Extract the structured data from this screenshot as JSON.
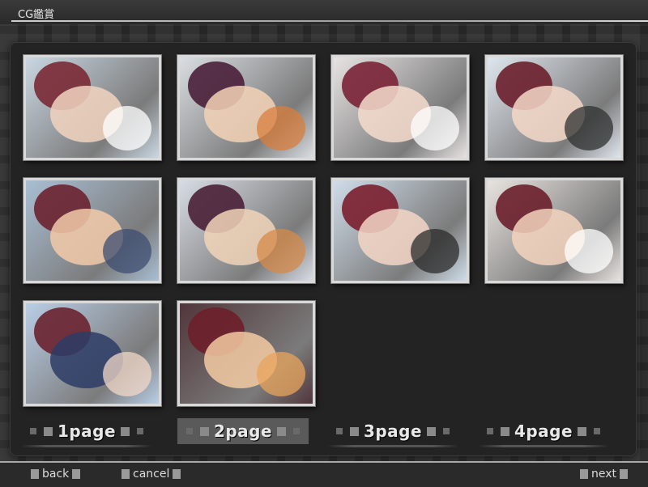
{
  "window": {
    "title": "CG鑑賞"
  },
  "gallery": {
    "thumbnails": [
      {
        "name": "cg-thumbnail-1",
        "bg": "#c9d7e2",
        "a": "#f1d3c0",
        "b": "#7a2a35",
        "c": "#ffffff"
      },
      {
        "name": "cg-thumbnail-2",
        "bg": "#d9dee2",
        "a": "#f3d2b6",
        "b": "#4a1f3a",
        "c": "#d97d3e"
      },
      {
        "name": "cg-thumbnail-3",
        "bg": "#e7e3e3",
        "a": "#f5dccd",
        "b": "#7a2236",
        "c": "#ffffff"
      },
      {
        "name": "cg-thumbnail-4",
        "bg": "#dfe6ee",
        "a": "#f4d8c8",
        "b": "#6a1f2c",
        "c": "#2f3232"
      },
      {
        "name": "cg-thumbnail-5",
        "bg": "#a9bfd4",
        "a": "#f2caa9",
        "b": "#6c2230",
        "c": "#3e4d72"
      },
      {
        "name": "cg-thumbnail-6",
        "bg": "#d7dce4",
        "a": "#f1d3b9",
        "b": "#4a2036",
        "c": "#d6894a"
      },
      {
        "name": "cg-thumbnail-7",
        "bg": "#cfdde9",
        "a": "#f3d6c5",
        "b": "#7b1f2f",
        "c": "#2b2b2b"
      },
      {
        "name": "cg-thumbnail-8",
        "bg": "#e8e3df",
        "a": "#f3d4bd",
        "b": "#6a1f2b",
        "c": "#ffffff"
      },
      {
        "name": "cg-thumbnail-9",
        "bg": "#b9cee6",
        "a": "#2d3c66",
        "b": "#6a2230",
        "c": "#f1d8c8"
      },
      {
        "name": "cg-thumbnail-10",
        "bg": "#51363a",
        "a": "#f3caa2",
        "b": "#6d1f2a",
        "c": "#e8a45c"
      }
    ]
  },
  "pagination": {
    "pages": [
      "1page",
      "2page",
      "3page",
      "4page"
    ],
    "active_page": "2page"
  },
  "footer": {
    "back_label": "back",
    "cancel_label": "cancel",
    "next_label": "next"
  }
}
